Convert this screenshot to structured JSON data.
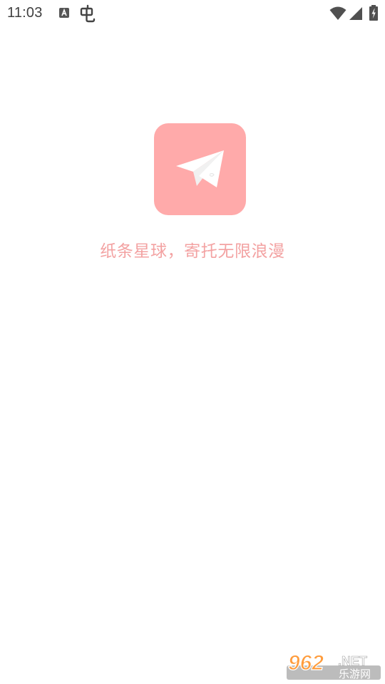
{
  "status_bar": {
    "time": "11:03",
    "icons": [
      "accessibility-a-icon",
      "bug-icon",
      "wifi-icon",
      "cell-signal-icon",
      "battery-charging-icon"
    ]
  },
  "splash": {
    "logo_icon": "paper-plane-icon",
    "logo_bg": "#ffaaaa",
    "slogan": "纸条星球，寄托无限浪漫",
    "slogan_color": "#f3a2a2"
  },
  "watermark": {
    "number": "962",
    "suffix": ".NET",
    "subtitle": "乐游网"
  }
}
